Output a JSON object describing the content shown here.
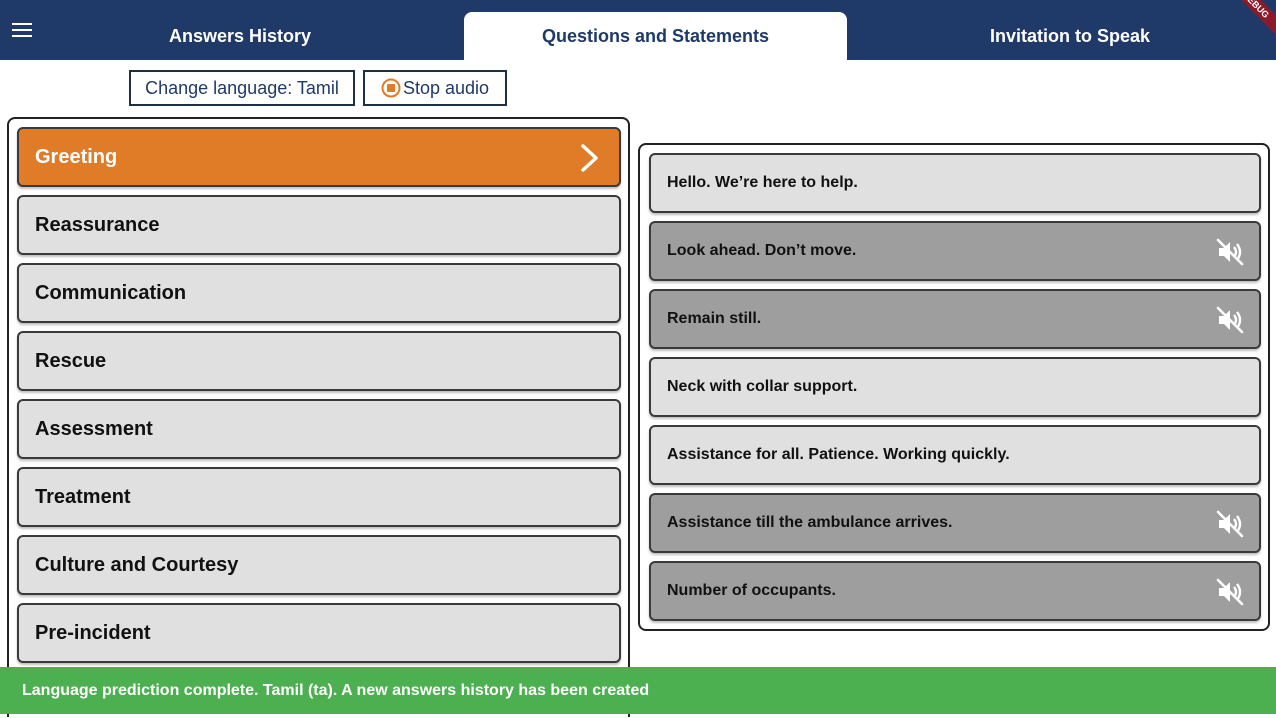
{
  "header": {
    "tabs": [
      {
        "label": "Answers History",
        "active": false
      },
      {
        "label": "Questions and Statements",
        "active": true
      },
      {
        "label": "Invitation to Speak",
        "active": false
      }
    ],
    "debug_banner": "DEBUG",
    "menu_icon": "hamburger-menu-icon"
  },
  "toolbar": {
    "change_language_label": "Change language: Tamil",
    "stop_audio_label": "Stop audio",
    "stop_audio_icon": "stop-circle-icon"
  },
  "categories": [
    {
      "label": "Greeting",
      "selected": true
    },
    {
      "label": "Reassurance",
      "selected": false
    },
    {
      "label": "Communication",
      "selected": false
    },
    {
      "label": "Rescue",
      "selected": false
    },
    {
      "label": "Assessment",
      "selected": false
    },
    {
      "label": "Treatment",
      "selected": false
    },
    {
      "label": "Culture and Courtesy",
      "selected": false
    },
    {
      "label": "Pre-incident",
      "selected": false
    }
  ],
  "statements": [
    {
      "text": "Hello. We’re here to help.",
      "audio_available": true
    },
    {
      "text": "Look ahead. Don’t move.",
      "audio_available": false
    },
    {
      "text": "Remain still.",
      "audio_available": false
    },
    {
      "text": "Neck with collar support.",
      "audio_available": true
    },
    {
      "text": "Assistance for all. Patience. Working quickly.",
      "audio_available": true
    },
    {
      "text": "Assistance till the ambulance arrives.",
      "audio_available": false
    },
    {
      "text": "Number of occupants.",
      "audio_available": false
    }
  ],
  "snackbar": {
    "message": "Language prediction complete. Tamil (ta). A new answers history has been created"
  },
  "colors": {
    "header_bg": "#1f3a68",
    "selected_category": "#e07b28",
    "item_bg": "#e0e0e0",
    "muted_item_bg": "#9e9e9e",
    "snackbar_bg": "#4caf50"
  }
}
